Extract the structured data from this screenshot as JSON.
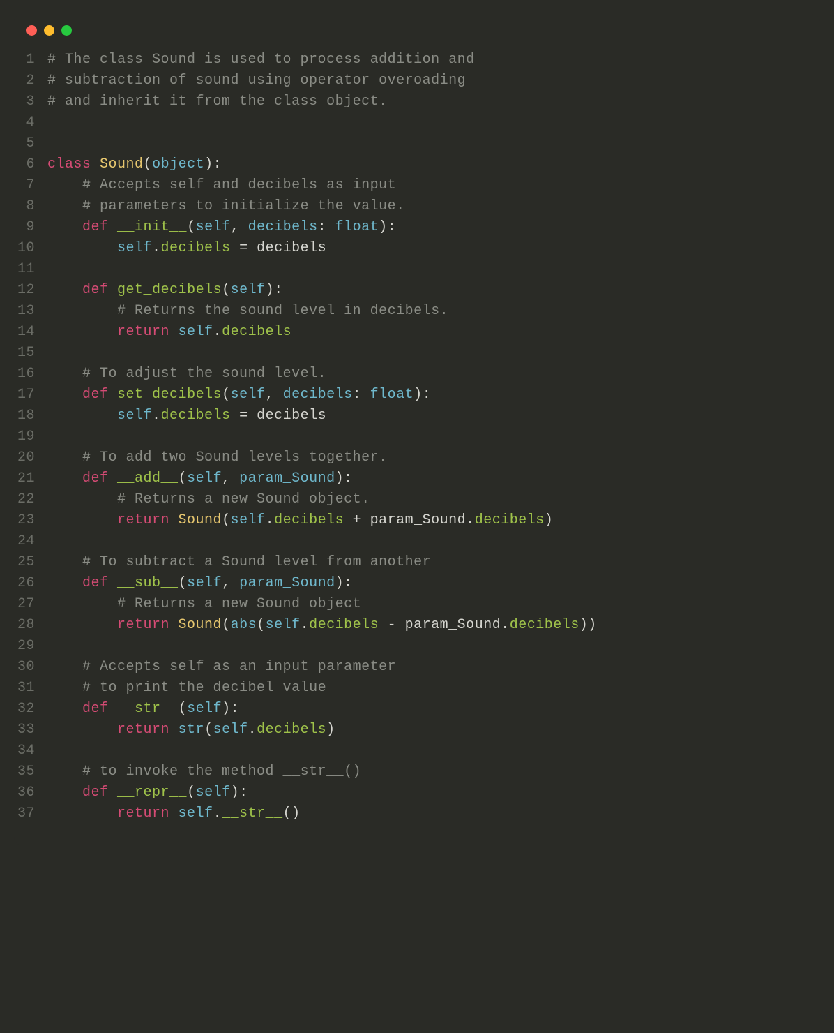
{
  "titlebar": {
    "buttons": [
      "close",
      "minimize",
      "zoom"
    ]
  },
  "colors": {
    "background": "#2a2b26",
    "gutter": "#6b6d66",
    "default": "#d6d6d0",
    "comment": "#8a8c85",
    "keyword": "#d44b74",
    "class": "#e6c66e",
    "builtin": "#6fb8cc",
    "function": "#9fc24a",
    "attr": "#9fc24a"
  },
  "lines": {
    "n1": "1",
    "n2": "2",
    "n3": "3",
    "n4": "4",
    "n5": "5",
    "n6": "6",
    "n7": "7",
    "n8": "8",
    "n9": "9",
    "n10": "10",
    "n11": "11",
    "n12": "12",
    "n13": "13",
    "n14": "14",
    "n15": "15",
    "n16": "16",
    "n17": "17",
    "n18": "18",
    "n19": "19",
    "n20": "20",
    "n21": "21",
    "n22": "22",
    "n23": "23",
    "n24": "24",
    "n25": "25",
    "n26": "26",
    "n27": "27",
    "n28": "28",
    "n29": "29",
    "n30": "30",
    "n31": "31",
    "n32": "32",
    "n33": "33",
    "n34": "34",
    "n35": "35",
    "n36": "36",
    "n37": "37"
  },
  "t": {
    "c1": "# The class Sound is used to process addition and",
    "c2": "# subtraction of sound using operator overoading",
    "c3": "# and inherit it from the class object.",
    "kw_class": "class",
    "cls_sound": "Sound",
    "builtin_object": "object",
    "c7": "# Accepts self and decibels as input",
    "c8": "# parameters to initialize the value.",
    "kw_def": "def",
    "fn_init": "__init__",
    "p_self": "self",
    "p_decibels": "decibels",
    "builtin_float": "float",
    "attr_decibels": "decibels",
    "id_decibels": "decibels",
    "fn_get_decibels": "get_decibels",
    "c13": "# Returns the sound level in decibels.",
    "kw_return": "return",
    "c16": "# To adjust the sound level.",
    "fn_set_decibels": "set_decibels",
    "c20": "# To add two Sound levels together.",
    "fn_add": "__add__",
    "p_param_sound": "param_Sound",
    "c22": "# Returns a new Sound object.",
    "id_param_sound": "param_Sound",
    "c25": "# To subtract a Sound level from another",
    "fn_sub": "__sub__",
    "c27": "# Returns a new Sound object",
    "builtin_abs": "abs",
    "c30": "# Accepts self as an input parameter",
    "c31": "# to print the decibel value",
    "fn_str": "__str__",
    "builtin_str": "str",
    "c35": "# to invoke the method __str__()",
    "fn_repr": "__repr__",
    "call_str": "__str__",
    "lp": "(",
    "rp": ")",
    "colon": ":",
    "comma": ", ",
    "dot": ".",
    "eq": " = ",
    "plus": " + ",
    "minus": " - ",
    "sp4": "    ",
    "sp8": "        "
  }
}
